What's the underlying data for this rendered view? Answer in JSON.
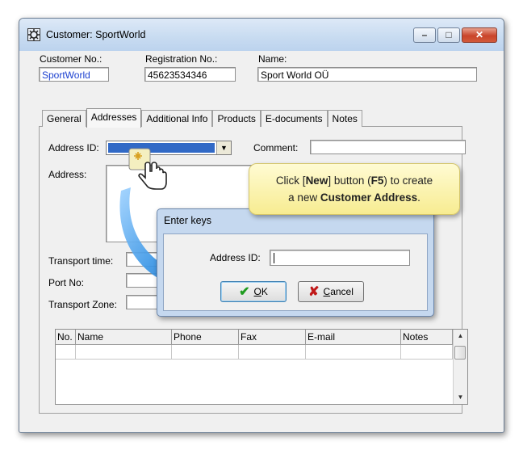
{
  "window": {
    "title": "Customer: SportWorld",
    "controls": [
      "minimize",
      "maximize",
      "close"
    ]
  },
  "header": {
    "customer_no": {
      "label": "Customer No.:",
      "value": "SportWorld"
    },
    "registration_no": {
      "label": "Registration No.:",
      "value": "45623534346"
    },
    "name": {
      "label": "Name:",
      "value": "Sport World OÜ"
    }
  },
  "tabs": [
    {
      "label": "General",
      "active": false
    },
    {
      "label": "Addresses",
      "active": true
    },
    {
      "label": "Additional Info",
      "active": false
    },
    {
      "label": "Products",
      "active": false
    },
    {
      "label": "E-documents",
      "active": false
    },
    {
      "label": "Notes",
      "active": false
    }
  ],
  "addresses": {
    "address_id_label": "Address ID:",
    "comment_label": "Comment:",
    "address_label": "Address:",
    "transport_time_label": "Transport time:",
    "port_no_label": "Port No:",
    "transport_zone_label": "Transport Zone:"
  },
  "contacts_table": {
    "columns": [
      "No.",
      "Name",
      "Phone",
      "Fax",
      "E-mail",
      "Notes"
    ]
  },
  "dialog": {
    "title": "Enter keys",
    "field_label": "Address ID:",
    "field_value": "",
    "ok_label": "OK",
    "ok_mnemonic": "O",
    "cancel_label": "Cancel",
    "cancel_mnemonic": "C"
  },
  "callout": {
    "line1_prefix": "Click [",
    "line1_new": "New",
    "line1_mid": "] button (",
    "line1_key": "F5",
    "line1_suffix": ") to create",
    "line2_prefix": "a new ",
    "line2_bold": "Customer Address",
    "line2_suffix": "."
  },
  "colors": {
    "accent_blue": "#3169c6",
    "callout_yellow": "#f7ec91",
    "arrow_blue": "#2f86d8",
    "ok_check": "#1e9b1e",
    "cancel_x": "#c01818"
  }
}
